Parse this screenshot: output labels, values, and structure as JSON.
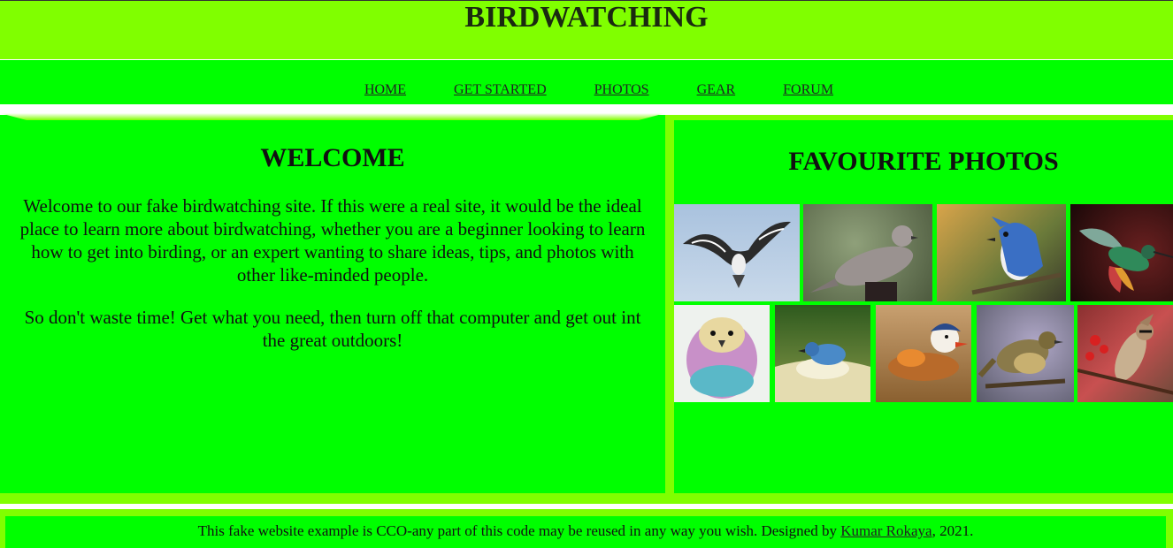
{
  "header": {
    "title": "BIRDWATCHING"
  },
  "nav": {
    "items": [
      "HOME",
      "GET STARTED",
      "PHOTOS",
      "GEAR",
      "FORUM"
    ]
  },
  "welcome": {
    "title": "WELCOME",
    "paragraph1": "Welcome to our fake birdwatching site. If this were a real site, it would be the ideal place to learn more about birdwatching, whether you are a beginner looking to learn how to get into birding, or an expert wanting to share ideas, tips, and photos with other like-minded people.",
    "paragraph2": "So don't waste time! Get what you need, then turn off that computer and get out int the great outdoors!"
  },
  "photos": {
    "title": "FAVOURITE PHOTOS",
    "images": [
      {
        "subject": "osprey",
        "icon": "osprey-photo"
      },
      {
        "subject": "mourning dove",
        "icon": "dove-photo"
      },
      {
        "subject": "blue jay",
        "icon": "blue-jay-photo"
      },
      {
        "subject": "hummingbird",
        "icon": "hummingbird-photo"
      },
      {
        "subject": "lilac-breasted roller",
        "icon": "roller-photo"
      },
      {
        "subject": "bathing bluebird",
        "icon": "bluebird-photo"
      },
      {
        "subject": "mandarin duck",
        "icon": "mandarin-duck-photo"
      },
      {
        "subject": "sparrow",
        "icon": "sparrow-photo"
      },
      {
        "subject": "cedar waxwing",
        "icon": "waxwing-photo"
      }
    ]
  },
  "footer": {
    "text_before": "This fake website example is CCO-any part of this code may be reused in any way you wish. Designed by ",
    "link": "Kumar Rokaya",
    "text_after": ", 2021."
  },
  "colors": {
    "lime": "#80ff00",
    "green": "#00ff00",
    "white": "#ffffff"
  }
}
